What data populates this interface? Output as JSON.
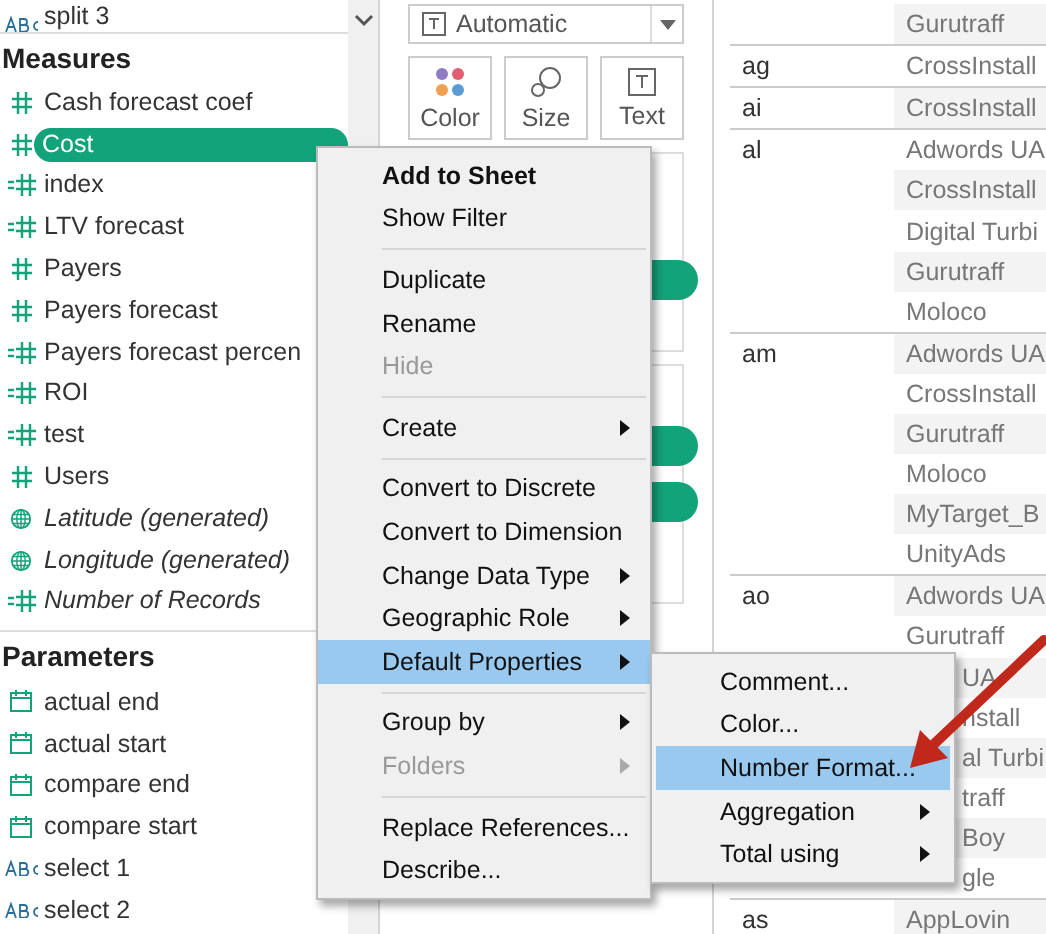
{
  "data_pane": {
    "top_item": {
      "kind": "text",
      "label": "split 3"
    },
    "measures": {
      "title": "Measures",
      "items": [
        {
          "kind": "measure",
          "label": "Cash forecast coef",
          "italic": false,
          "selected": false
        },
        {
          "kind": "measure",
          "label": "Cost",
          "italic": false,
          "selected": true
        },
        {
          "kind": "calculated",
          "label": "index",
          "italic": false,
          "selected": false
        },
        {
          "kind": "calculated",
          "label": "LTV forecast",
          "italic": false,
          "selected": false
        },
        {
          "kind": "measure",
          "label": "Payers",
          "italic": false,
          "selected": false
        },
        {
          "kind": "measure",
          "label": "Payers forecast",
          "italic": false,
          "selected": false
        },
        {
          "kind": "calculated",
          "label": "Payers forecast percen",
          "italic": false,
          "selected": false
        },
        {
          "kind": "calculated",
          "label": "ROI",
          "italic": false,
          "selected": false
        },
        {
          "kind": "calculated",
          "label": "test",
          "italic": false,
          "selected": false
        },
        {
          "kind": "measure",
          "label": "Users",
          "italic": false,
          "selected": false
        },
        {
          "kind": "geo",
          "label": "Latitude (generated)",
          "italic": true,
          "selected": false
        },
        {
          "kind": "geo",
          "label": "Longitude (generated)",
          "italic": true,
          "selected": false
        },
        {
          "kind": "calculated",
          "label": "Number of Records",
          "italic": true,
          "selected": false
        }
      ]
    },
    "parameters": {
      "title": "Parameters",
      "items": [
        {
          "kind": "date",
          "label": "actual end"
        },
        {
          "kind": "date",
          "label": "actual start"
        },
        {
          "kind": "date",
          "label": "compare end"
        },
        {
          "kind": "date",
          "label": "compare start"
        },
        {
          "kind": "text",
          "label": "select 1"
        },
        {
          "kind": "text",
          "label": "select 2"
        }
      ]
    }
  },
  "marks_card": {
    "mark_type": "Automatic",
    "buttons": [
      {
        "kind": "color",
        "label": "Color"
      },
      {
        "kind": "size",
        "label": "Size"
      },
      {
        "kind": "text",
        "label": "Text"
      }
    ]
  },
  "table": {
    "groups": [
      {
        "rows": [
          {
            "value": "Gurutraff"
          }
        ]
      },
      {
        "label": "ag",
        "rows": [
          {
            "value": "CrossInstall"
          }
        ]
      },
      {
        "label": "ai",
        "rows": [
          {
            "value": "CrossInstall"
          }
        ]
      },
      {
        "label": "al",
        "rows": [
          {
            "value": "Adwords UA"
          },
          {
            "value": "CrossInstall"
          },
          {
            "value": "Digital Turbi"
          },
          {
            "value": "Gurutraff"
          },
          {
            "value": "Moloco"
          }
        ]
      },
      {
        "label": "am",
        "rows": [
          {
            "value": "Adwords UA"
          },
          {
            "value": "CrossInstall"
          },
          {
            "value": "Gurutraff"
          },
          {
            "value": "Moloco"
          },
          {
            "value": "MyTarget_B"
          },
          {
            "value": "UnityAds"
          }
        ]
      },
      {
        "label": "ao",
        "rows": [
          {
            "value": "Adwords UA"
          },
          {
            "value": "Gurutraff"
          },
          {
            "value": "UA",
            "covered": true
          },
          {
            "value": "nstall",
            "covered": true
          },
          {
            "value": "al Turbi",
            "covered": true
          },
          {
            "value": "traff",
            "covered": true
          },
          {
            "value": "Boy",
            "covered": true
          },
          {
            "value": "gle",
            "covered": true
          }
        ]
      },
      {
        "label": "as",
        "rows": [
          {
            "value": "AppLovin"
          }
        ]
      }
    ]
  },
  "context_menu": {
    "items": [
      {
        "kind": "item",
        "label": "Add to Sheet",
        "bold": true,
        "disabled": false,
        "submenu": false,
        "selected": false
      },
      {
        "kind": "item",
        "label": "Show Filter",
        "bold": false,
        "disabled": false,
        "submenu": false,
        "selected": false
      },
      {
        "kind": "separator"
      },
      {
        "kind": "item",
        "label": "Duplicate",
        "bold": false,
        "disabled": false,
        "submenu": false,
        "selected": false
      },
      {
        "kind": "item",
        "label": "Rename",
        "bold": false,
        "disabled": false,
        "submenu": false,
        "selected": false
      },
      {
        "kind": "item",
        "label": "Hide",
        "bold": false,
        "disabled": true,
        "submenu": false,
        "selected": false
      },
      {
        "kind": "separator"
      },
      {
        "kind": "item",
        "label": "Create",
        "bold": false,
        "disabled": false,
        "submenu": true,
        "selected": false
      },
      {
        "kind": "separator"
      },
      {
        "kind": "item",
        "label": "Convert to Discrete",
        "bold": false,
        "disabled": false,
        "submenu": false,
        "selected": false
      },
      {
        "kind": "item",
        "label": "Convert to Dimension",
        "bold": false,
        "disabled": false,
        "submenu": false,
        "selected": false
      },
      {
        "kind": "item",
        "label": "Change Data Type",
        "bold": false,
        "disabled": false,
        "submenu": true,
        "selected": false
      },
      {
        "kind": "item",
        "label": "Geographic Role",
        "bold": false,
        "disabled": false,
        "submenu": true,
        "selected": false
      },
      {
        "kind": "item",
        "label": "Default Properties",
        "bold": false,
        "disabled": false,
        "submenu": true,
        "selected": true
      },
      {
        "kind": "separator"
      },
      {
        "kind": "item",
        "label": "Group by",
        "bold": false,
        "disabled": false,
        "submenu": true,
        "selected": false
      },
      {
        "kind": "item",
        "label": "Folders",
        "bold": false,
        "disabled": true,
        "submenu": true,
        "selected": false
      },
      {
        "kind": "separator"
      },
      {
        "kind": "item",
        "label": "Replace References...",
        "bold": false,
        "disabled": false,
        "submenu": false,
        "selected": false
      },
      {
        "kind": "item",
        "label": "Describe...",
        "bold": false,
        "disabled": false,
        "submenu": false,
        "selected": false
      }
    ]
  },
  "submenu": {
    "items": [
      {
        "label": "Comment...",
        "submenu": false,
        "selected": false
      },
      {
        "label": "Color...",
        "submenu": false,
        "selected": false
      },
      {
        "label": "Number Format...",
        "submenu": false,
        "selected": true
      },
      {
        "label": "Aggregation",
        "submenu": true,
        "selected": false
      },
      {
        "label": "Total using",
        "submenu": true,
        "selected": false
      }
    ]
  }
}
